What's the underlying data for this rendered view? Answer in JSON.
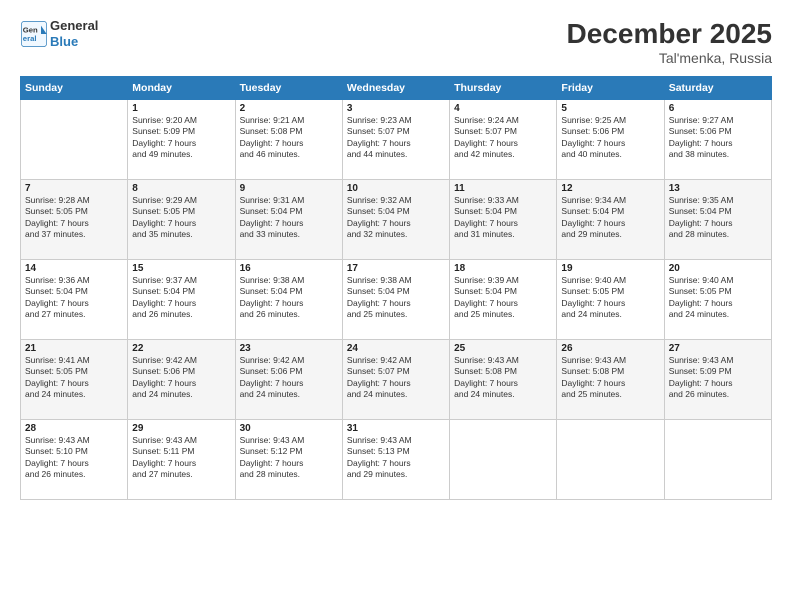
{
  "logo": {
    "line1": "General",
    "line2": "Blue"
  },
  "title": "December 2025",
  "subtitle": "Tal'menka, Russia",
  "days_header": [
    "Sunday",
    "Monday",
    "Tuesday",
    "Wednesday",
    "Thursday",
    "Friday",
    "Saturday"
  ],
  "weeks": [
    [
      {
        "day": "",
        "info": ""
      },
      {
        "day": "1",
        "info": "Sunrise: 9:20 AM\nSunset: 5:09 PM\nDaylight: 7 hours\nand 49 minutes."
      },
      {
        "day": "2",
        "info": "Sunrise: 9:21 AM\nSunset: 5:08 PM\nDaylight: 7 hours\nand 46 minutes."
      },
      {
        "day": "3",
        "info": "Sunrise: 9:23 AM\nSunset: 5:07 PM\nDaylight: 7 hours\nand 44 minutes."
      },
      {
        "day": "4",
        "info": "Sunrise: 9:24 AM\nSunset: 5:07 PM\nDaylight: 7 hours\nand 42 minutes."
      },
      {
        "day": "5",
        "info": "Sunrise: 9:25 AM\nSunset: 5:06 PM\nDaylight: 7 hours\nand 40 minutes."
      },
      {
        "day": "6",
        "info": "Sunrise: 9:27 AM\nSunset: 5:06 PM\nDaylight: 7 hours\nand 38 minutes."
      }
    ],
    [
      {
        "day": "7",
        "info": "Sunrise: 9:28 AM\nSunset: 5:05 PM\nDaylight: 7 hours\nand 37 minutes."
      },
      {
        "day": "8",
        "info": "Sunrise: 9:29 AM\nSunset: 5:05 PM\nDaylight: 7 hours\nand 35 minutes."
      },
      {
        "day": "9",
        "info": "Sunrise: 9:31 AM\nSunset: 5:04 PM\nDaylight: 7 hours\nand 33 minutes."
      },
      {
        "day": "10",
        "info": "Sunrise: 9:32 AM\nSunset: 5:04 PM\nDaylight: 7 hours\nand 32 minutes."
      },
      {
        "day": "11",
        "info": "Sunrise: 9:33 AM\nSunset: 5:04 PM\nDaylight: 7 hours\nand 31 minutes."
      },
      {
        "day": "12",
        "info": "Sunrise: 9:34 AM\nSunset: 5:04 PM\nDaylight: 7 hours\nand 29 minutes."
      },
      {
        "day": "13",
        "info": "Sunrise: 9:35 AM\nSunset: 5:04 PM\nDaylight: 7 hours\nand 28 minutes."
      }
    ],
    [
      {
        "day": "14",
        "info": "Sunrise: 9:36 AM\nSunset: 5:04 PM\nDaylight: 7 hours\nand 27 minutes."
      },
      {
        "day": "15",
        "info": "Sunrise: 9:37 AM\nSunset: 5:04 PM\nDaylight: 7 hours\nand 26 minutes."
      },
      {
        "day": "16",
        "info": "Sunrise: 9:38 AM\nSunset: 5:04 PM\nDaylight: 7 hours\nand 26 minutes."
      },
      {
        "day": "17",
        "info": "Sunrise: 9:38 AM\nSunset: 5:04 PM\nDaylight: 7 hours\nand 25 minutes."
      },
      {
        "day": "18",
        "info": "Sunrise: 9:39 AM\nSunset: 5:04 PM\nDaylight: 7 hours\nand 25 minutes."
      },
      {
        "day": "19",
        "info": "Sunrise: 9:40 AM\nSunset: 5:05 PM\nDaylight: 7 hours\nand 24 minutes."
      },
      {
        "day": "20",
        "info": "Sunrise: 9:40 AM\nSunset: 5:05 PM\nDaylight: 7 hours\nand 24 minutes."
      }
    ],
    [
      {
        "day": "21",
        "info": "Sunrise: 9:41 AM\nSunset: 5:05 PM\nDaylight: 7 hours\nand 24 minutes."
      },
      {
        "day": "22",
        "info": "Sunrise: 9:42 AM\nSunset: 5:06 PM\nDaylight: 7 hours\nand 24 minutes."
      },
      {
        "day": "23",
        "info": "Sunrise: 9:42 AM\nSunset: 5:06 PM\nDaylight: 7 hours\nand 24 minutes."
      },
      {
        "day": "24",
        "info": "Sunrise: 9:42 AM\nSunset: 5:07 PM\nDaylight: 7 hours\nand 24 minutes."
      },
      {
        "day": "25",
        "info": "Sunrise: 9:43 AM\nSunset: 5:08 PM\nDaylight: 7 hours\nand 24 minutes."
      },
      {
        "day": "26",
        "info": "Sunrise: 9:43 AM\nSunset: 5:08 PM\nDaylight: 7 hours\nand 25 minutes."
      },
      {
        "day": "27",
        "info": "Sunrise: 9:43 AM\nSunset: 5:09 PM\nDaylight: 7 hours\nand 26 minutes."
      }
    ],
    [
      {
        "day": "28",
        "info": "Sunrise: 9:43 AM\nSunset: 5:10 PM\nDaylight: 7 hours\nand 26 minutes."
      },
      {
        "day": "29",
        "info": "Sunrise: 9:43 AM\nSunset: 5:11 PM\nDaylight: 7 hours\nand 27 minutes."
      },
      {
        "day": "30",
        "info": "Sunrise: 9:43 AM\nSunset: 5:12 PM\nDaylight: 7 hours\nand 28 minutes."
      },
      {
        "day": "31",
        "info": "Sunrise: 9:43 AM\nSunset: 5:13 PM\nDaylight: 7 hours\nand 29 minutes."
      },
      {
        "day": "",
        "info": ""
      },
      {
        "day": "",
        "info": ""
      },
      {
        "day": "",
        "info": ""
      }
    ]
  ]
}
